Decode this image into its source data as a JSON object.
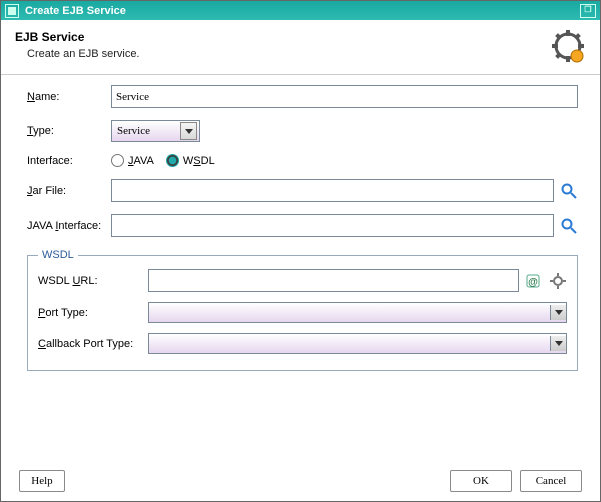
{
  "window": {
    "title": "Create EJB Service"
  },
  "header": {
    "title": "EJB Service",
    "subtitle": "Create an EJB service."
  },
  "form": {
    "name": {
      "mnemonic": "N",
      "rest": "ame:",
      "value": "Service"
    },
    "type": {
      "mnemonic": "T",
      "rest": "ype:",
      "value": "Service"
    },
    "interface": {
      "label": "Interface:",
      "options": [
        {
          "mnemonic": "J",
          "rest": "AVA",
          "selected": false
        },
        {
          "pre": "W",
          "mnemonic": "S",
          "rest": "DL",
          "selected": true
        }
      ]
    },
    "jar": {
      "mnemonic": "J",
      "rest": "ar File:",
      "value": ""
    },
    "javaInterface": {
      "pre": "JAVA ",
      "mnemonic": "I",
      "rest": "nterface:",
      "value": ""
    },
    "wsdl": {
      "legend": "WSDL",
      "url": {
        "pre": "WSDL ",
        "mnemonic": "U",
        "rest": "RL:",
        "value": ""
      },
      "portType": {
        "mnemonic": "P",
        "rest": "ort Type:",
        "value": ""
      },
      "callbackPortType": {
        "mnemonic": "C",
        "rest": "allback Port Type:",
        "value": ""
      }
    }
  },
  "footer": {
    "help": "Help",
    "ok": "OK",
    "cancel": "Cancel"
  }
}
